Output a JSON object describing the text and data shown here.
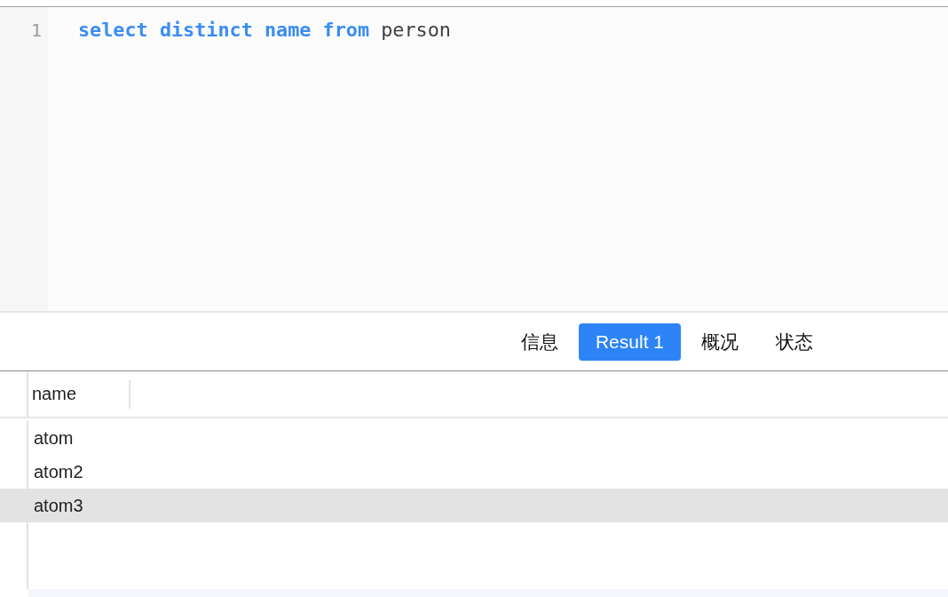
{
  "editor": {
    "lines": [
      {
        "number": "1",
        "tokens": [
          {
            "text": "select",
            "kind": "keyword"
          },
          {
            "text": "distinct",
            "kind": "keyword"
          },
          {
            "text": "name",
            "kind": "keyword"
          },
          {
            "text": "from",
            "kind": "keyword"
          },
          {
            "text": "person",
            "kind": "identifier"
          }
        ]
      }
    ]
  },
  "result_tabs": [
    {
      "label": "信息",
      "selected": false
    },
    {
      "label": "Result 1",
      "selected": true
    },
    {
      "label": "概况",
      "selected": false
    },
    {
      "label": "状态",
      "selected": false
    }
  ],
  "table": {
    "columns": [
      "name"
    ],
    "rows": [
      {
        "cells": [
          "atom"
        ],
        "highlighted": false
      },
      {
        "cells": [
          "atom2"
        ],
        "highlighted": false
      },
      {
        "cells": [
          "atom3"
        ],
        "highlighted": true
      }
    ]
  }
}
